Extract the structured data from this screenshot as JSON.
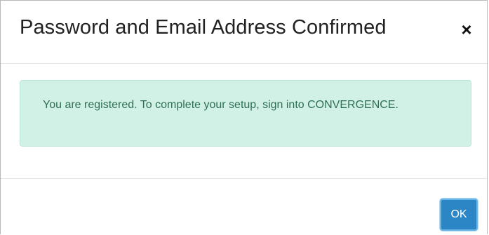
{
  "dialog": {
    "title": "Password and Email Address Confirmed",
    "close_icon": "close-icon",
    "close_glyph": "×",
    "message": "You are registered. To complete your setup, sign into CONVERGENCE.",
    "ok_label": "OK"
  },
  "colors": {
    "alert_background": "#d1f1e6",
    "alert_text": "#2f6f55",
    "primary_button": "#2c86c6"
  }
}
